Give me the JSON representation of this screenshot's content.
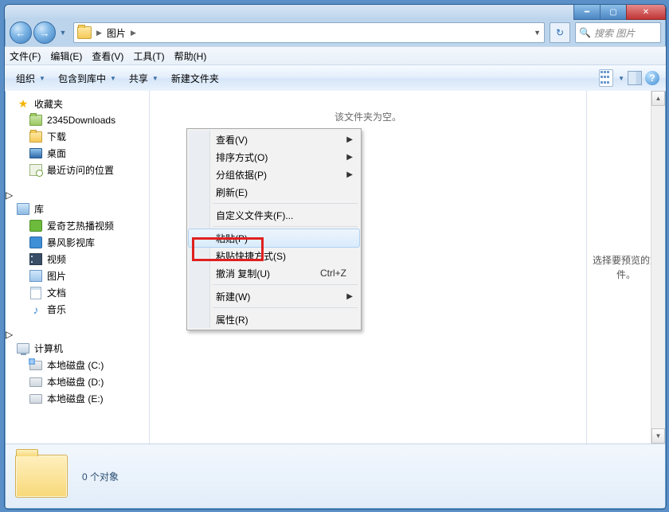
{
  "titlebar": {},
  "address": {
    "folder_name": "图片",
    "separator": "▶"
  },
  "search": {
    "placeholder": "搜索 图片"
  },
  "menubar": {
    "file": "文件(F)",
    "edit": "编辑(E)",
    "view": "查看(V)",
    "tools": "工具(T)",
    "help": "帮助(H)"
  },
  "toolbar": {
    "organize": "组织",
    "include": "包含到库中",
    "share": "共享",
    "new_folder": "新建文件夹"
  },
  "sidebar": {
    "favorites": {
      "label": "收藏夹",
      "items": [
        "2345Downloads",
        "下载",
        "桌面",
        "最近访问的位置"
      ]
    },
    "libraries": {
      "label": "库",
      "items": [
        "爱奇艺热播视频",
        "暴风影视库",
        "视频",
        "图片",
        "文档",
        "音乐"
      ]
    },
    "computer": {
      "label": "计算机",
      "items": [
        "本地磁盘 (C:)",
        "本地磁盘 (D:)",
        "本地磁盘 (E:)"
      ]
    }
  },
  "main": {
    "empty_text": "该文件夹为空。",
    "preview_text": "选择要预览的文件。"
  },
  "context_menu": {
    "view": "查看(V)",
    "sort": "排序方式(O)",
    "group": "分组依据(P)",
    "refresh": "刷新(E)",
    "customize": "自定义文件夹(F)...",
    "paste": "粘贴(P)",
    "paste_shortcut": "粘贴快捷方式(S)",
    "undo": "撤消 复制(U)",
    "undo_key": "Ctrl+Z",
    "new": "新建(W)",
    "properties": "属性(R)"
  },
  "status": {
    "objects": "0 个对象"
  }
}
